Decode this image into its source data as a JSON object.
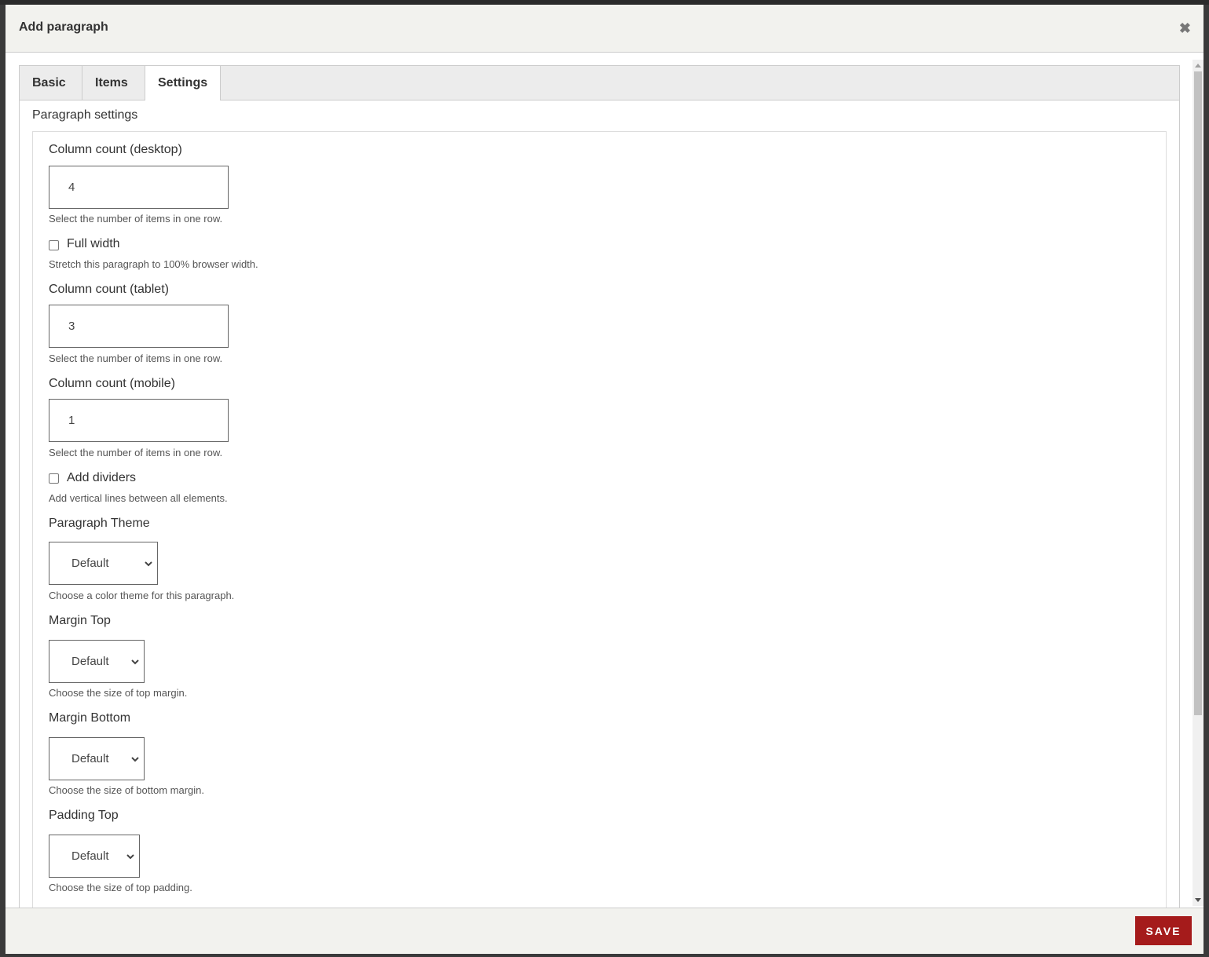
{
  "dialog": {
    "title": "Add paragraph",
    "close_icon": "close-icon"
  },
  "tabs": [
    {
      "label": "Basic",
      "active": false
    },
    {
      "label": "Items",
      "active": false
    },
    {
      "label": "Settings",
      "active": true
    }
  ],
  "settings": {
    "legend": "Paragraph settings",
    "column_desktop": {
      "label": "Column count (desktop)",
      "value": "4",
      "description": "Select the number of items in one row."
    },
    "full_width": {
      "label": "Full width",
      "checked": false,
      "description": "Stretch this paragraph to 100% browser width."
    },
    "column_tablet": {
      "label": "Column count (tablet)",
      "value": "3",
      "description": "Select the number of items in one row."
    },
    "column_mobile": {
      "label": "Column count (mobile)",
      "value": "1",
      "description": "Select the number of items in one row."
    },
    "add_dividers": {
      "label": "Add dividers",
      "checked": false,
      "description": "Add vertical lines between all elements."
    },
    "theme": {
      "label": "Paragraph Theme",
      "value": "Default",
      "description": "Choose a color theme for this paragraph."
    },
    "margin_top": {
      "label": "Margin Top",
      "value": "Default",
      "description": "Choose the size of top margin."
    },
    "margin_bottom": {
      "label": "Margin Bottom",
      "value": "Default",
      "description": "Choose the size of bottom margin."
    },
    "padding_top": {
      "label": "Padding Top",
      "value": "Default",
      "description": "Choose the size of top padding."
    }
  },
  "footer": {
    "save_label": "SAVE",
    "save_color": "#a51b1b"
  }
}
